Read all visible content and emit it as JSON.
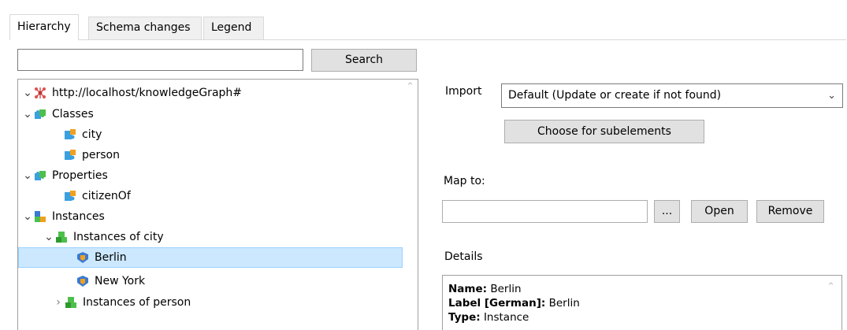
{
  "tabs": [
    {
      "label": "Hierarchy",
      "active": true
    },
    {
      "label": "Schema changes",
      "active": false
    },
    {
      "label": "Legend",
      "active": false
    }
  ],
  "search": {
    "value": "",
    "button_label": "Search"
  },
  "tree": {
    "root": "http://localhost/knowledgeGraph#",
    "classes": "Classes",
    "city": "city",
    "person": "person",
    "properties": "Properties",
    "citizenOf": "citizenOf",
    "instances": "Instances",
    "instances_of_city": "Instances of city",
    "berlin": "Berlin",
    "new_york": "New York",
    "instances_of_person": "Instances of person"
  },
  "import": {
    "label": "Import",
    "selected": "Default (Update or create if not found)",
    "choose_button": "Choose for subelements"
  },
  "map_to": {
    "label": "Map to:",
    "value": "",
    "browse_button": "...",
    "open_button": "Open",
    "remove_button": "Remove"
  },
  "details": {
    "label": "Details",
    "name_key": "Name:",
    "name_value": "Berlin",
    "label_key": "Label [German]:",
    "label_value": "Berlin",
    "type_key": "Type:",
    "type_value": "Instance"
  },
  "colors": {
    "selection": "#cce8ff",
    "selection_border": "#99d1ff",
    "button_bg": "#e1e1e1",
    "tab_bg": "#f0f0f0"
  }
}
